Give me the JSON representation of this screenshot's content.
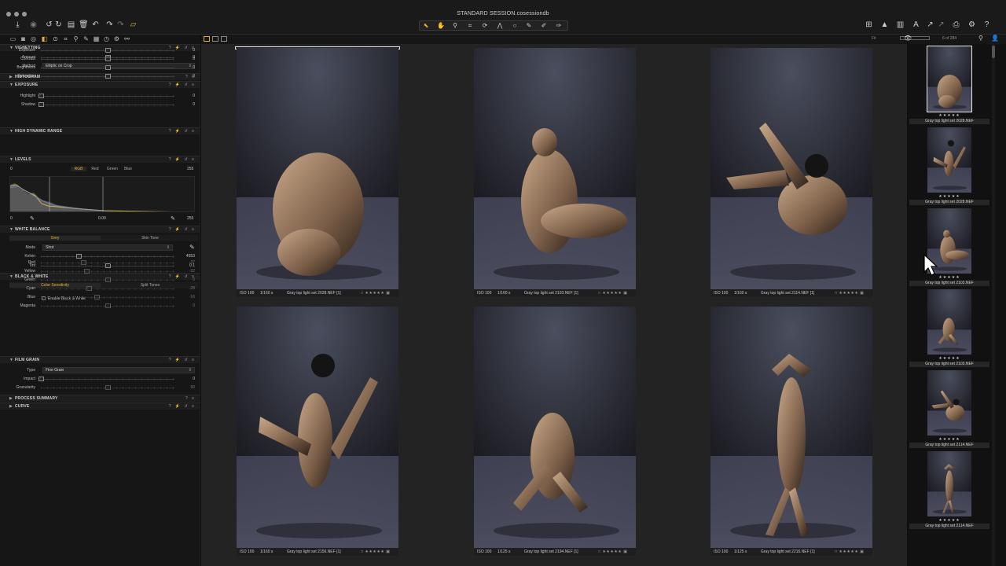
{
  "window": {
    "title": "STANDARD SESSION.cosessiondb",
    "image_count": "6 of 284"
  },
  "icons": {
    "left_toolbar": [
      "import-icon",
      "camera-icon",
      "rotate-left-icon",
      "rotate-right-icon",
      "stack-icon",
      "trash-icon",
      "undo-icon",
      "redo-icon",
      "copy-icon",
      "paste-icon"
    ],
    "right_toolbar": [
      "grid-view-icon",
      "warning-icon",
      "exposure-warning-icon",
      "text-icon",
      "cursor-tools-icon",
      "print-icon",
      "settings-icon",
      "help-icon"
    ]
  },
  "tools": {
    "vignetting": {
      "title": "VIGNETTING",
      "amount_label": "Amount",
      "amount_value": "0",
      "amount_pct": 0.5,
      "method_label": "Method",
      "method_value": "Elliptic on Crop"
    },
    "histogram": {
      "title": "HISTOGRAM"
    },
    "exposure": {
      "title": "EXPOSURE",
      "rows": [
        {
          "label": "Exposure",
          "value": "0",
          "pct": 0.5
        },
        {
          "label": "Contrast",
          "value": "0",
          "pct": 0.5
        },
        {
          "label": "Brightness",
          "value": "0",
          "pct": 0.5
        },
        {
          "label": "Saturation",
          "value": "0",
          "pct": 0.5
        }
      ]
    },
    "hdr": {
      "title": "HIGH DYNAMIC RANGE",
      "rows": [
        {
          "label": "Highlight",
          "value": "0",
          "pct": 0.0
        },
        {
          "label": "Shadow",
          "value": "0",
          "pct": 0.0
        }
      ]
    },
    "levels": {
      "title": "LEVELS",
      "min_input": "0",
      "max_input": "255",
      "channels": [
        "RGB",
        "Red",
        "Green",
        "Blue"
      ],
      "active_channel": "RGB",
      "min_output": "0",
      "mid_value": "0.00",
      "max_output": "255"
    },
    "white_balance": {
      "title": "WHITE BALANCE",
      "tabs": [
        "Grey",
        "Skin Tone"
      ],
      "mode_label": "Mode",
      "mode_value": "Shot",
      "kelvin_label": "Kelvin",
      "kelvin_value": "4553",
      "kelvin_pct": 0.28,
      "tint_label": "Tint",
      "tint_value": "0.1",
      "tint_pct": 0.5
    },
    "black_white": {
      "title": "BLACK & WHITE",
      "tabs": [
        "Color Sensitivity",
        "Split Tones"
      ],
      "enable_label": "Enable Black & White",
      "rows": [
        {
          "label": "Red",
          "value": "-37",
          "pct": 0.32
        },
        {
          "label": "Yellow",
          "value": "-32",
          "pct": 0.34
        },
        {
          "label": "Green",
          "value": "0",
          "pct": 0.5
        },
        {
          "label": "Cyan",
          "value": "-28",
          "pct": 0.36
        },
        {
          "label": "Blue",
          "value": "-16",
          "pct": 0.42
        },
        {
          "label": "Magenta",
          "value": "0",
          "pct": 0.5
        }
      ]
    },
    "film_grain": {
      "title": "FILM GRAIN",
      "type_label": "Type",
      "type_value": "Fine Grain",
      "impact_label": "Impact",
      "impact_value": "0",
      "impact_pct": 0.0,
      "granularity_label": "Granularity",
      "granularity_value": "50",
      "granularity_pct": 0.5
    },
    "process_summary": {
      "title": "PROCESS SUMMARY"
    },
    "curve": {
      "title": "CURVE"
    }
  },
  "grid": [
    {
      "iso": "ISO 100",
      "shutter": "1/160 s",
      "filename": "Gray top light set 2028.NEF [1]",
      "selected": true
    },
    {
      "iso": "ISO 100",
      "shutter": "1/160 s",
      "filename": "Gray top light set 2103.NEF [1]",
      "selected": false
    },
    {
      "iso": "ISO 100",
      "shutter": "1/160 s",
      "filename": "Gray top light set 2114.NEF [1]",
      "selected": false
    },
    {
      "iso": "ISO 100",
      "shutter": "1/160 s",
      "filename": "Gray top light set 2156.NEF [1]",
      "selected": false
    },
    {
      "iso": "ISO 100",
      "shutter": "1/125 s",
      "filename": "Gray top light set 2194.NEF [1]",
      "selected": false
    },
    {
      "iso": "ISO 100",
      "shutter": "1/125 s",
      "filename": "Gray top light set 2216.NEF [1]",
      "selected": false
    }
  ],
  "rating_stars": "★★★★★",
  "filmstrip": [
    {
      "filename": "Gray top light set 2028.NEF",
      "selected": true
    },
    {
      "filename": "Gray top light set 2028.NEF",
      "selected": false
    },
    {
      "filename": "Gray top light set 2103.NEF",
      "selected": false
    },
    {
      "filename": "Gray top light set 2103.NEF",
      "selected": false
    },
    {
      "filename": "Gray top light set 2114.NEF",
      "selected": false
    },
    {
      "filename": "Gray top light set 2114.NEF",
      "selected": false
    }
  ],
  "colors": {
    "accent": "#e0b13a",
    "panel": "#161616",
    "browser_bg": "#232323"
  }
}
